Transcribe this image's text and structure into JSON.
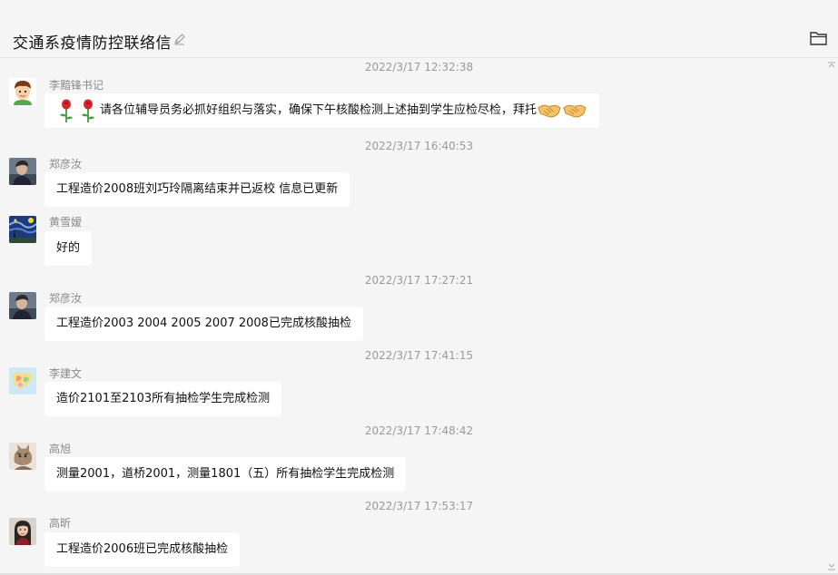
{
  "header": {
    "title": "交通系疫情防控联络信"
  },
  "icons": {
    "edit": "pencil-edit-icon",
    "folder": "folder-icon"
  },
  "messages": [
    {
      "timestamp": "2022/3/17 12:32:38",
      "sender": "李黯锋书记",
      "avatar": "cartoon-boy-avatar",
      "text": "请各位辅导员务必抓好组织与落实，确保下午核酸检测上述抽到学生应检尽检，拜托",
      "emoji_before": [
        "rose",
        "rose"
      ],
      "emoji_after": [
        "handshake",
        "handshake"
      ]
    },
    {
      "timestamp": "2022/3/17 16:40:53",
      "sender": "郑彦汝",
      "avatar": "photo-avatar",
      "text": "工程造价2008班刘巧玲隔离结束并已返校 信息已更新"
    },
    {
      "timestamp": "",
      "sender": "黄雪嫒",
      "avatar": "starry-night-avatar",
      "text": "好的"
    },
    {
      "timestamp": "2022/3/17 17:27:21",
      "sender": "郑彦汝",
      "avatar": "photo-avatar",
      "text": "工程造价2003 2004 2005 2007 2008已完成核酸抽检"
    },
    {
      "timestamp": "2022/3/17 17:41:15",
      "sender": "李建文",
      "avatar": "map-avatar",
      "text": "造价2101至2103所有抽检学生完成检测"
    },
    {
      "timestamp": "2022/3/17 17:48:42",
      "sender": "高旭",
      "avatar": "cat-avatar",
      "text": "测量2001，道桥2001，测量1801（五）所有抽检学生完成检测"
    },
    {
      "timestamp": "2022/3/17 17:53:17",
      "sender": "高昕",
      "avatar": "portrait-avatar",
      "text": "工程造价2006班已完成核酸抽检"
    }
  ]
}
